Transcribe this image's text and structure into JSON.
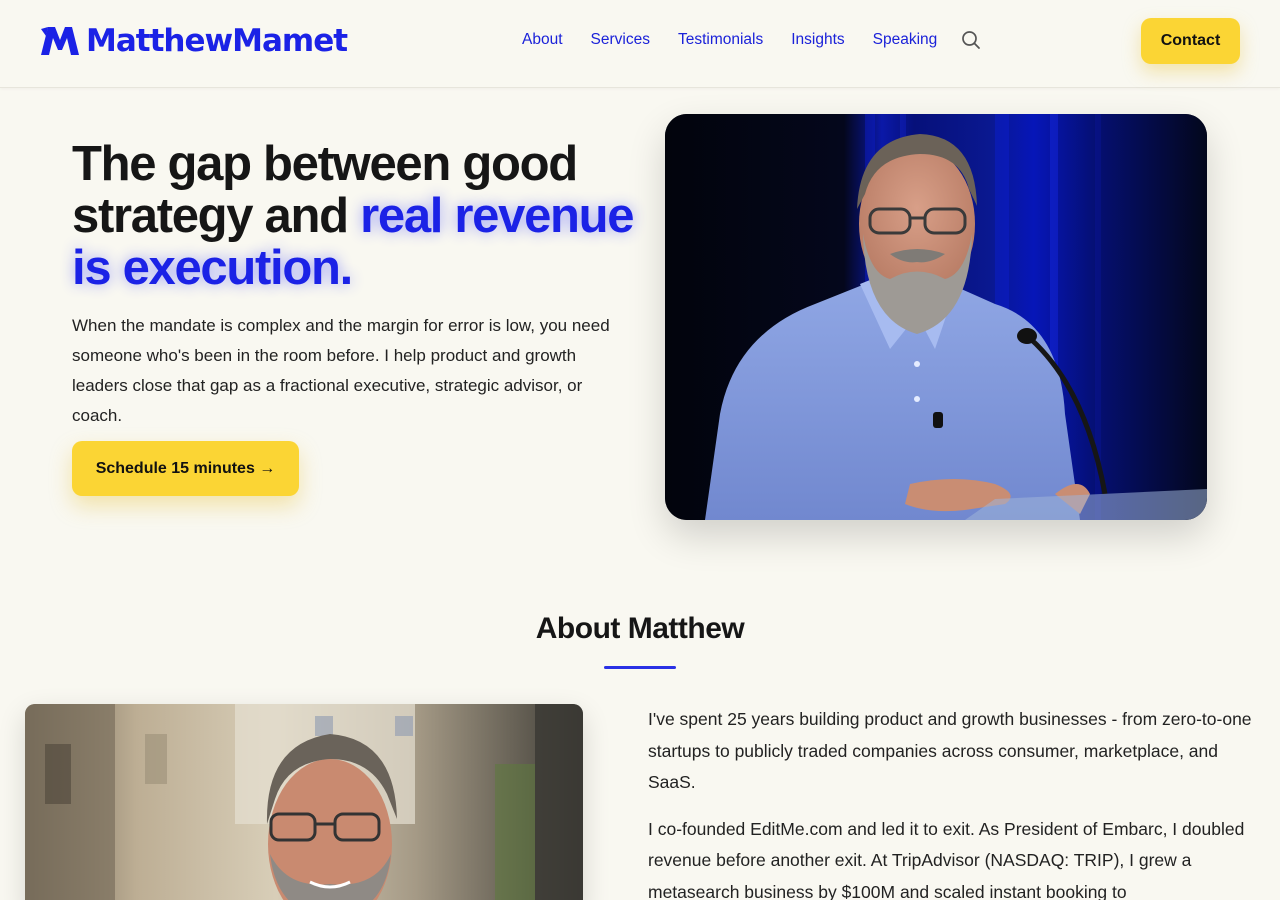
{
  "header": {
    "brand": "MatthewMamet",
    "nav": [
      "About",
      "Services",
      "Testimonials",
      "Insights",
      "Speaking"
    ],
    "contact_label": "Contact"
  },
  "hero": {
    "title_plain": "The gap between good strategy and ",
    "title_accent": "real revenue is execution.",
    "body": "When the mandate is complex and the margin for error is low, you need someone who's been in the room before. I help product and growth leaders close that gap as a fractional executive, strategic advisor, or coach.",
    "cta_label": "Schedule 15 minutes →"
  },
  "about": {
    "title": "About Matthew",
    "paragraphs": [
      "I've spent 25 years building product and growth businesses - from zero-to-one startups to publicly traded companies across consumer, marketplace, and SaaS.",
      "I co-founded EditMe.com and led it to exit. As President of Embarc, I doubled revenue before another exit. At TripAdvisor (NASDAQ: TRIP), I grew a metasearch business by $100M and scaled instant booking to"
    ]
  },
  "colors": {
    "accent": "#1b22e6",
    "cta": "#fbd534",
    "background": "#f9f8f1"
  },
  "icons": [
    "logo-m-icon",
    "search-icon"
  ]
}
